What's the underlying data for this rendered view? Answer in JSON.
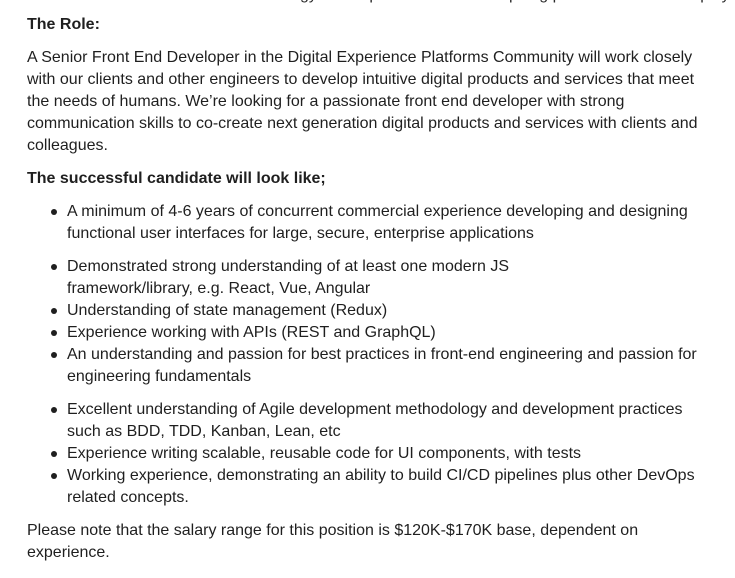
{
  "role_heading": "The Role:",
  "role_paragraph": "A Senior Front End Developer in the Digital Experience Platforms Community will work closely with our clients and other engineers to develop intuitive digital products and services that meet the needs of humans. We’re looking for a passionate front end developer with strong communication skills to co-create next generation digital products and services with clients and colleagues.",
  "candidate_heading": "The successful candidate will look like;",
  "requirements_group1": [
    "A minimum of 4-6 years of concurrent commercial experience developing and designing functional user interfaces for large, secure, enterprise applications"
  ],
  "requirements_group2": [
    "Demonstrated strong understanding of at least one modern JS framework/library, e.g. React, Vue, Angular",
    "Understanding of state management (Redux)",
    "Experience working with APIs (REST and GraphQL)",
    "An understanding and passion for best practices in front-end engineering and passion for engineering fundamentals"
  ],
  "requirements_group3": [
    "Excellent understanding of Agile development methodology and development practices such as BDD, TDD, Kanban, Lean, etc",
    "Experience writing scalable, reusable code for UI components, with tests",
    "Working experience, demonstrating an ability to build CI/CD pipelines plus other DevOps related concepts."
  ],
  "salary_note": "Please note that the salary range for this position is $120K-$170K base, dependent on experience."
}
